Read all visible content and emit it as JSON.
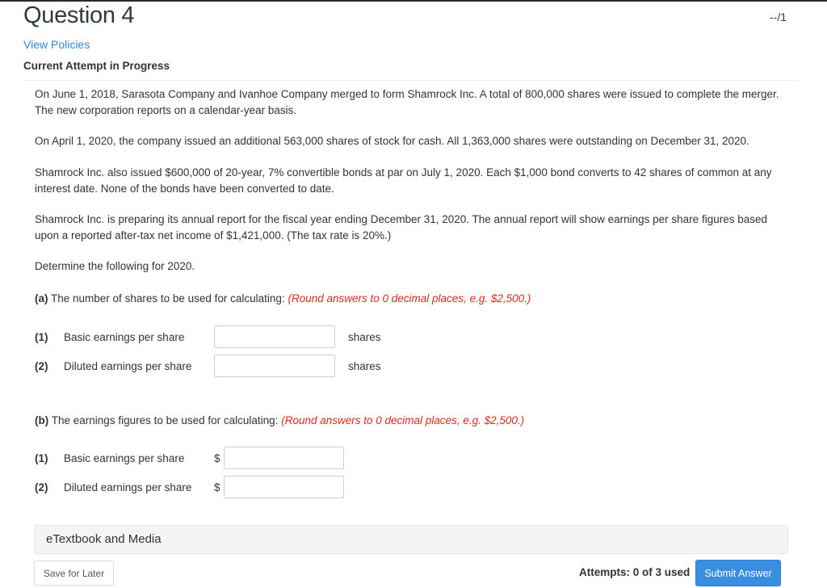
{
  "header": {
    "title": "Question 4",
    "score": "--/1",
    "policies_link": "View Policies",
    "attempt_status": "Current Attempt in Progress"
  },
  "problem": {
    "paragraphs": [
      "On June 1, 2018, Sarasota Company and Ivanhoe Company merged to form Shamrock Inc. A total of 800,000 shares were issued to complete the merger. The new corporation reports on a calendar-year basis.",
      "On April 1, 2020, the company issued an additional 563,000 shares of stock for cash. All 1,363,000 shares were outstanding on December 31, 2020.",
      "Shamrock Inc. also issued $600,000 of 20-year, 7% convertible bonds at par on July 1, 2020. Each $1,000 bond converts to 42 shares of common at any interest date. None of the bonds have been converted to date.",
      "Shamrock Inc. is preparing its annual report for the fiscal year ending December 31, 2020. The annual report will show earnings per share figures based upon a reported after-tax net income of $1,421,000. (The tax rate is 20%.)",
      "Determine the following for 2020."
    ]
  },
  "part_a": {
    "label": "(a)",
    "prompt": "The number of shares to be used for calculating:",
    "instruction": "(Round answers to 0 decimal places, e.g. $2,500.)",
    "rows": [
      {
        "num": "(1)",
        "label": "Basic earnings per share",
        "value": "",
        "unit": "shares"
      },
      {
        "num": "(2)",
        "label": "Diluted earnings per share",
        "value": "",
        "unit": "shares"
      }
    ]
  },
  "part_b": {
    "label": "(b)",
    "prompt": "The earnings figures to be used for calculating:",
    "instruction": "(Round answers to 0 decimal places, e.g. $2,500.)",
    "rows": [
      {
        "num": "(1)",
        "label": "Basic earnings per share",
        "prefix": "$",
        "value": ""
      },
      {
        "num": "(2)",
        "label": "Diluted earnings per share",
        "prefix": "$",
        "value": ""
      }
    ]
  },
  "footer": {
    "etextbook": "eTextbook and Media",
    "save_label": "Save for Later",
    "attempts": "Attempts: 0 of 3 used",
    "submit_label": "Submit Answer"
  },
  "colors": {
    "link": "#2f86d6",
    "instruction": "#e0281e",
    "submit": "#3a8ee0"
  }
}
